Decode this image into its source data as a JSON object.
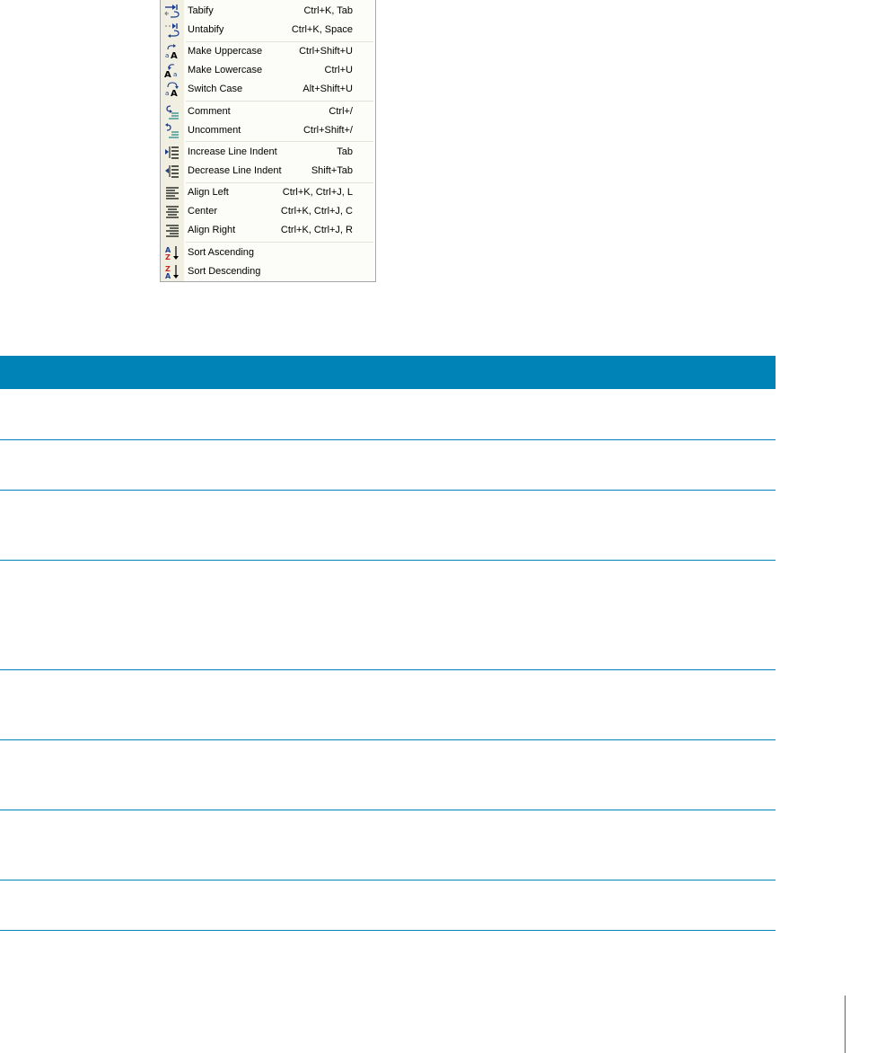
{
  "menu": {
    "items": [
      {
        "label": "Tabify",
        "shortcut": "Ctrl+K, Tab",
        "icon": "tabify-icon"
      },
      {
        "label": "Untabify",
        "shortcut": "Ctrl+K, Space",
        "icon": "untabify-icon"
      },
      {
        "label": "Make Uppercase",
        "shortcut": "Ctrl+Shift+U",
        "icon": "make-uppercase-icon"
      },
      {
        "label": "Make Lowercase",
        "shortcut": "Ctrl+U",
        "icon": "make-lowercase-icon"
      },
      {
        "label": "Switch Case",
        "shortcut": "Alt+Shift+U",
        "icon": "switch-case-icon"
      },
      {
        "label": "Comment",
        "shortcut": "Ctrl+/",
        "icon": "comment-icon"
      },
      {
        "label": "Uncomment",
        "shortcut": "Ctrl+Shift+/",
        "icon": "uncomment-icon"
      },
      {
        "label": "Increase Line Indent",
        "shortcut": "Tab",
        "icon": "increase-indent-icon"
      },
      {
        "label": "Decrease Line Indent",
        "shortcut": "Shift+Tab",
        "icon": "decrease-indent-icon"
      },
      {
        "label": "Align Left",
        "shortcut": "Ctrl+K, Ctrl+J, L",
        "icon": "align-left-icon"
      },
      {
        "label": "Center",
        "shortcut": "Ctrl+K, Ctrl+J, C",
        "icon": "align-center-icon"
      },
      {
        "label": "Align Right",
        "shortcut": "Ctrl+K, Ctrl+J, R",
        "icon": "align-right-icon"
      },
      {
        "label": "Sort Ascending",
        "shortcut": "",
        "icon": "sort-ascending-icon"
      },
      {
        "label": "Sort Descending",
        "shortcut": "",
        "icon": "sort-descending-icon"
      }
    ]
  },
  "colors": {
    "accent": "#0084b8",
    "menu_gutter": "#f1efe2",
    "menu_background": "#fcfcf9",
    "icon_blue": "#1c3c8c",
    "icon_red": "#c8281e"
  }
}
